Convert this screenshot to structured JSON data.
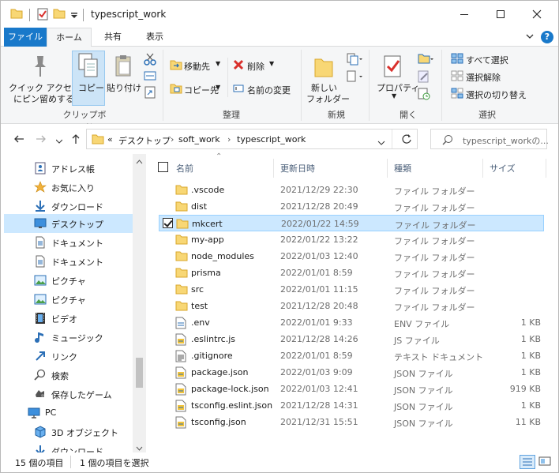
{
  "window": {
    "title": "typescript_work"
  },
  "ribbon": {
    "tabs": [
      {
        "label": "ファイル"
      },
      {
        "label": "ホーム"
      },
      {
        "label": "共有"
      },
      {
        "label": "表示"
      }
    ],
    "clipboard": {
      "pin_label_1": "クイック アクセス",
      "pin_label_2": "にピン留めする",
      "copy": "コピー",
      "paste": "貼り付け",
      "group": "クリップボード"
    },
    "organize": {
      "move_to": "移動先",
      "copy_to": "コピー先",
      "delete": "削除",
      "rename": "名前の変更",
      "group": "整理"
    },
    "new": {
      "new_folder_1": "新しい",
      "new_folder_2": "フォルダー",
      "group": "新規"
    },
    "open": {
      "properties": "プロパティ",
      "group": "開く"
    },
    "select": {
      "select_all": "すべて選択",
      "select_none": "選択解除",
      "invert": "選択の切り替え",
      "group": "選択"
    }
  },
  "address": {
    "prefix": "«",
    "crumbs": [
      "デスクトップ",
      "soft_work",
      "typescript_work"
    ],
    "search_placeholder": "typescript_workの..."
  },
  "nav": {
    "items": [
      {
        "label": "アドレス帳",
        "icon": "address-book-icon"
      },
      {
        "label": "お気に入り",
        "icon": "star-icon"
      },
      {
        "label": "ダウンロード",
        "icon": "download-icon"
      },
      {
        "label": "デスクトップ",
        "icon": "desktop-icon",
        "selected": true
      },
      {
        "label": "ドキュメント",
        "icon": "document-icon"
      },
      {
        "label": "ドキュメント",
        "icon": "document-icon"
      },
      {
        "label": "ピクチャ",
        "icon": "pictures-icon"
      },
      {
        "label": "ピクチャ",
        "icon": "pictures-icon"
      },
      {
        "label": "ビデオ",
        "icon": "video-icon"
      },
      {
        "label": "ミュージック",
        "icon": "music-icon"
      },
      {
        "label": "リンク",
        "icon": "link-icon"
      },
      {
        "label": "検索",
        "icon": "search-icon"
      },
      {
        "label": "保存したゲーム",
        "icon": "game-icon"
      },
      {
        "label": "PC",
        "icon": "pc-icon",
        "root": true
      },
      {
        "label": "3D オブジェクト",
        "icon": "3d-objects-icon"
      },
      {
        "label": "ダウンロード",
        "icon": "download-icon"
      }
    ]
  },
  "columns": {
    "name": "名前",
    "date": "更新日時",
    "type": "種類",
    "size": "サイズ"
  },
  "files": [
    {
      "name": ".vscode",
      "date": "2021/12/29 22:30",
      "type": "ファイル フォルダー",
      "size": "",
      "kind": "folder"
    },
    {
      "name": "dist",
      "date": "2021/12/28 20:49",
      "type": "ファイル フォルダー",
      "size": "",
      "kind": "folder"
    },
    {
      "name": "mkcert",
      "date": "2022/01/22 14:59",
      "type": "ファイル フォルダー",
      "size": "",
      "kind": "folder",
      "selected": true
    },
    {
      "name": "my-app",
      "date": "2022/01/22 13:22",
      "type": "ファイル フォルダー",
      "size": "",
      "kind": "folder"
    },
    {
      "name": "node_modules",
      "date": "2022/01/03 12:40",
      "type": "ファイル フォルダー",
      "size": "",
      "kind": "folder"
    },
    {
      "name": "prisma",
      "date": "2022/01/01 8:59",
      "type": "ファイル フォルダー",
      "size": "",
      "kind": "folder"
    },
    {
      "name": "src",
      "date": "2022/01/01 11:15",
      "type": "ファイル フォルダー",
      "size": "",
      "kind": "folder"
    },
    {
      "name": "test",
      "date": "2021/12/28 20:48",
      "type": "ファイル フォルダー",
      "size": "",
      "kind": "folder"
    },
    {
      "name": ".env",
      "date": "2022/01/01 9:33",
      "type": "ENV ファイル",
      "size": "1 KB",
      "kind": "env"
    },
    {
      "name": ".eslintrc.js",
      "date": "2021/12/28 14:26",
      "type": "JS ファイル",
      "size": "1 KB",
      "kind": "js"
    },
    {
      "name": ".gitignore",
      "date": "2022/01/01 8:59",
      "type": "テキスト ドキュメント",
      "size": "1 KB",
      "kind": "txt"
    },
    {
      "name": "package.json",
      "date": "2022/01/03 9:09",
      "type": "JSON ファイル",
      "size": "1 KB",
      "kind": "json"
    },
    {
      "name": "package-lock.json",
      "date": "2022/01/03 12:41",
      "type": "JSON ファイル",
      "size": "919 KB",
      "kind": "json"
    },
    {
      "name": "tsconfig.eslint.json",
      "date": "2021/12/28 14:31",
      "type": "JSON ファイル",
      "size": "1 KB",
      "kind": "json"
    },
    {
      "name": "tsconfig.json",
      "date": "2021/12/31 15:51",
      "type": "JSON ファイル",
      "size": "11 KB",
      "kind": "json"
    }
  ],
  "status": {
    "item_count": "15 個の項目",
    "selected": "1 個の項目を選択"
  },
  "colors": {
    "accent": "#1979ca",
    "selection": "#cce8ff",
    "folder": "#f8d775"
  }
}
